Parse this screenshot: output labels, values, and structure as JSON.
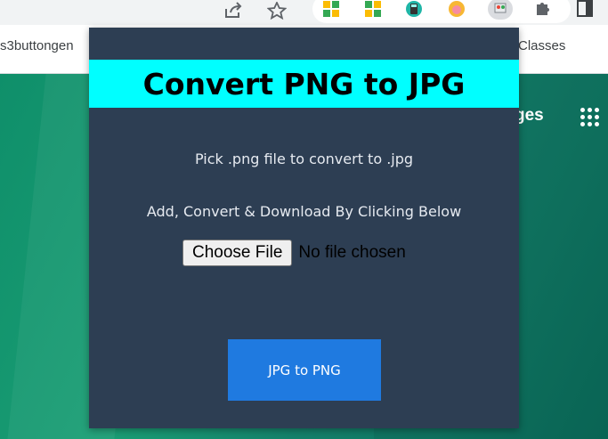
{
  "browser": {
    "bookmarks": {
      "left_label": "s3buttongen",
      "right_label": "Classes"
    }
  },
  "page": {
    "partial_link": "ges"
  },
  "popup": {
    "title": "Convert PNG to JPG",
    "instruction": "Pick .png file to convert to .jpg",
    "subinstruction": "Add, Convert & Download By Clicking Below",
    "choose_file_label": "Choose File",
    "file_status": "No file chosen",
    "convert_button": "JPG to PNG"
  },
  "colors": {
    "popup_bg": "#2d3e53",
    "title_bg": "#00ffff",
    "button_bg": "#1f7ae0",
    "page_bg": "#1a9e74"
  }
}
